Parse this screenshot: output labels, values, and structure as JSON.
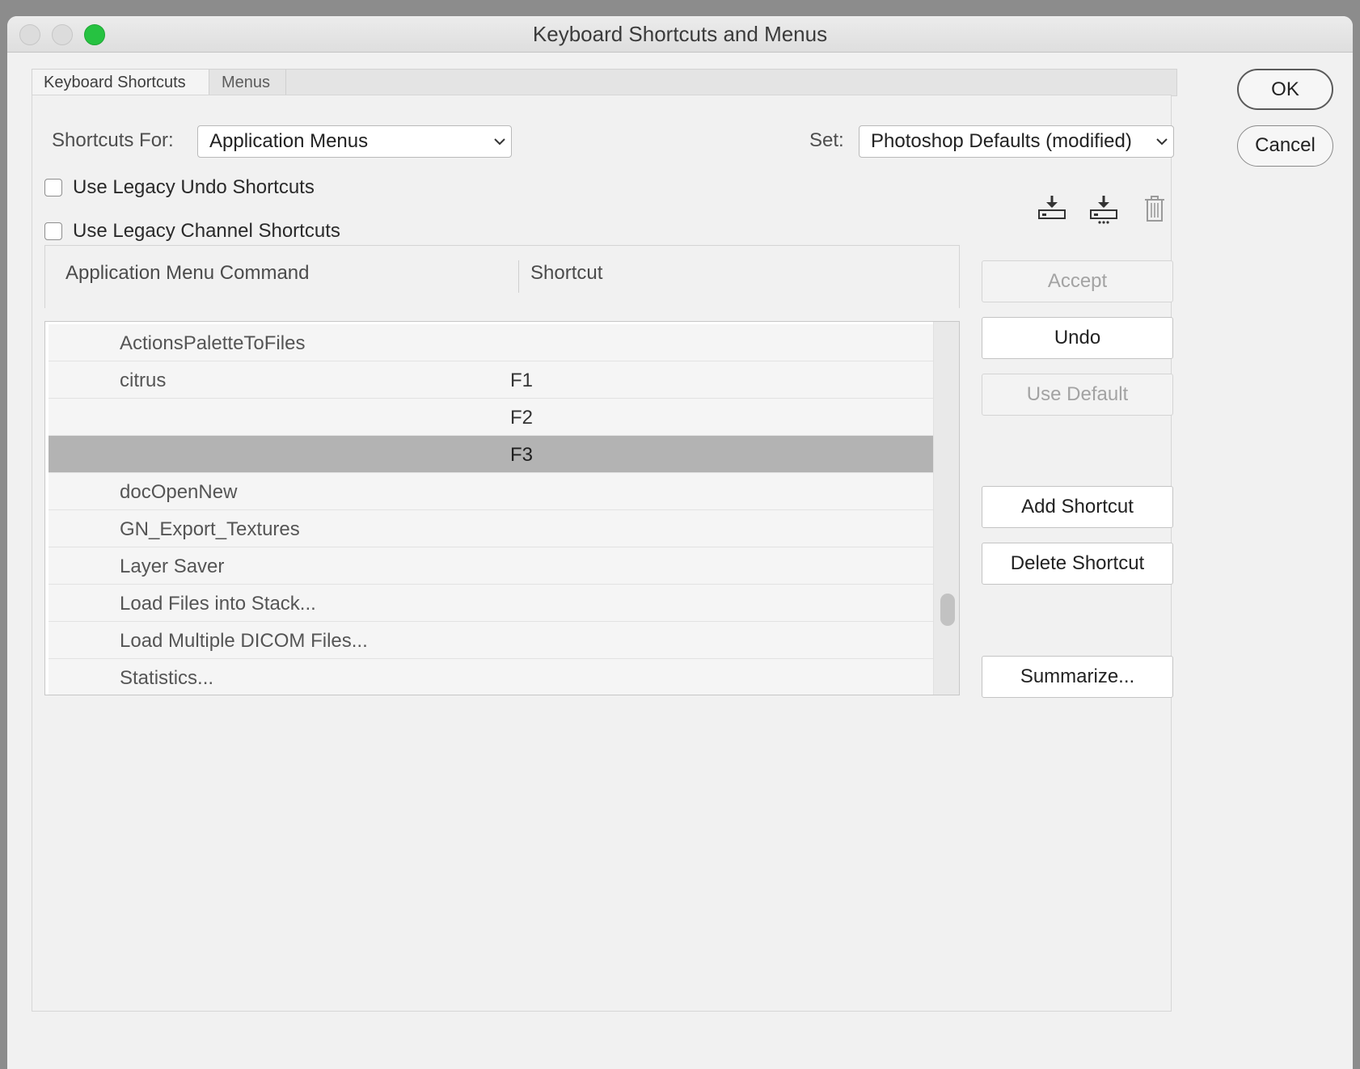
{
  "window": {
    "title": "Keyboard Shortcuts and Menus"
  },
  "tabs": [
    {
      "label": "Keyboard Shortcuts",
      "active": true
    },
    {
      "label": "Menus",
      "active": false
    }
  ],
  "shortcuts_for": {
    "label": "Shortcuts For:",
    "value": "Application Menus"
  },
  "set": {
    "label": "Set:",
    "value": "Photoshop Defaults (modified)"
  },
  "checkboxes": [
    {
      "label": "Use Legacy Undo Shortcuts",
      "checked": false
    },
    {
      "label": "Use Legacy Channel Shortcuts",
      "checked": false
    }
  ],
  "icons": [
    "save-set-icon",
    "save-set-as-icon",
    "delete-set-icon"
  ],
  "table": {
    "columns": [
      "Application Menu Command",
      "Shortcut"
    ],
    "rows": [
      {
        "command": "ActionsPaletteToFiles",
        "shortcut": "",
        "selected": false
      },
      {
        "command": "citrus",
        "shortcut": "F1",
        "selected": false
      },
      {
        "command": "",
        "shortcut": "F2",
        "selected": false
      },
      {
        "command": "",
        "shortcut": "F3",
        "selected": true
      },
      {
        "command": "docOpenNew",
        "shortcut": "",
        "selected": false
      },
      {
        "command": "GN_Export_Textures",
        "shortcut": "",
        "selected": false
      },
      {
        "command": "Layer Saver",
        "shortcut": "",
        "selected": false
      },
      {
        "command": "Load Files into Stack...",
        "shortcut": "",
        "selected": false
      },
      {
        "command": "Load Multiple DICOM Files...",
        "shortcut": "",
        "selected": false
      },
      {
        "command": "Statistics...",
        "shortcut": "",
        "selected": false
      }
    ]
  },
  "side_buttons": {
    "accept": "Accept",
    "undo": "Undo",
    "use_default": "Use Default",
    "add_shortcut": "Add Shortcut",
    "delete_shortcut": "Delete Shortcut",
    "summarize": "Summarize..."
  },
  "dialog_buttons": {
    "ok": "OK",
    "cancel": "Cancel"
  },
  "colors": {
    "selected_row": "#b3b3b3",
    "window_bg": "#f1f1f1",
    "maximize": "#26c241"
  }
}
